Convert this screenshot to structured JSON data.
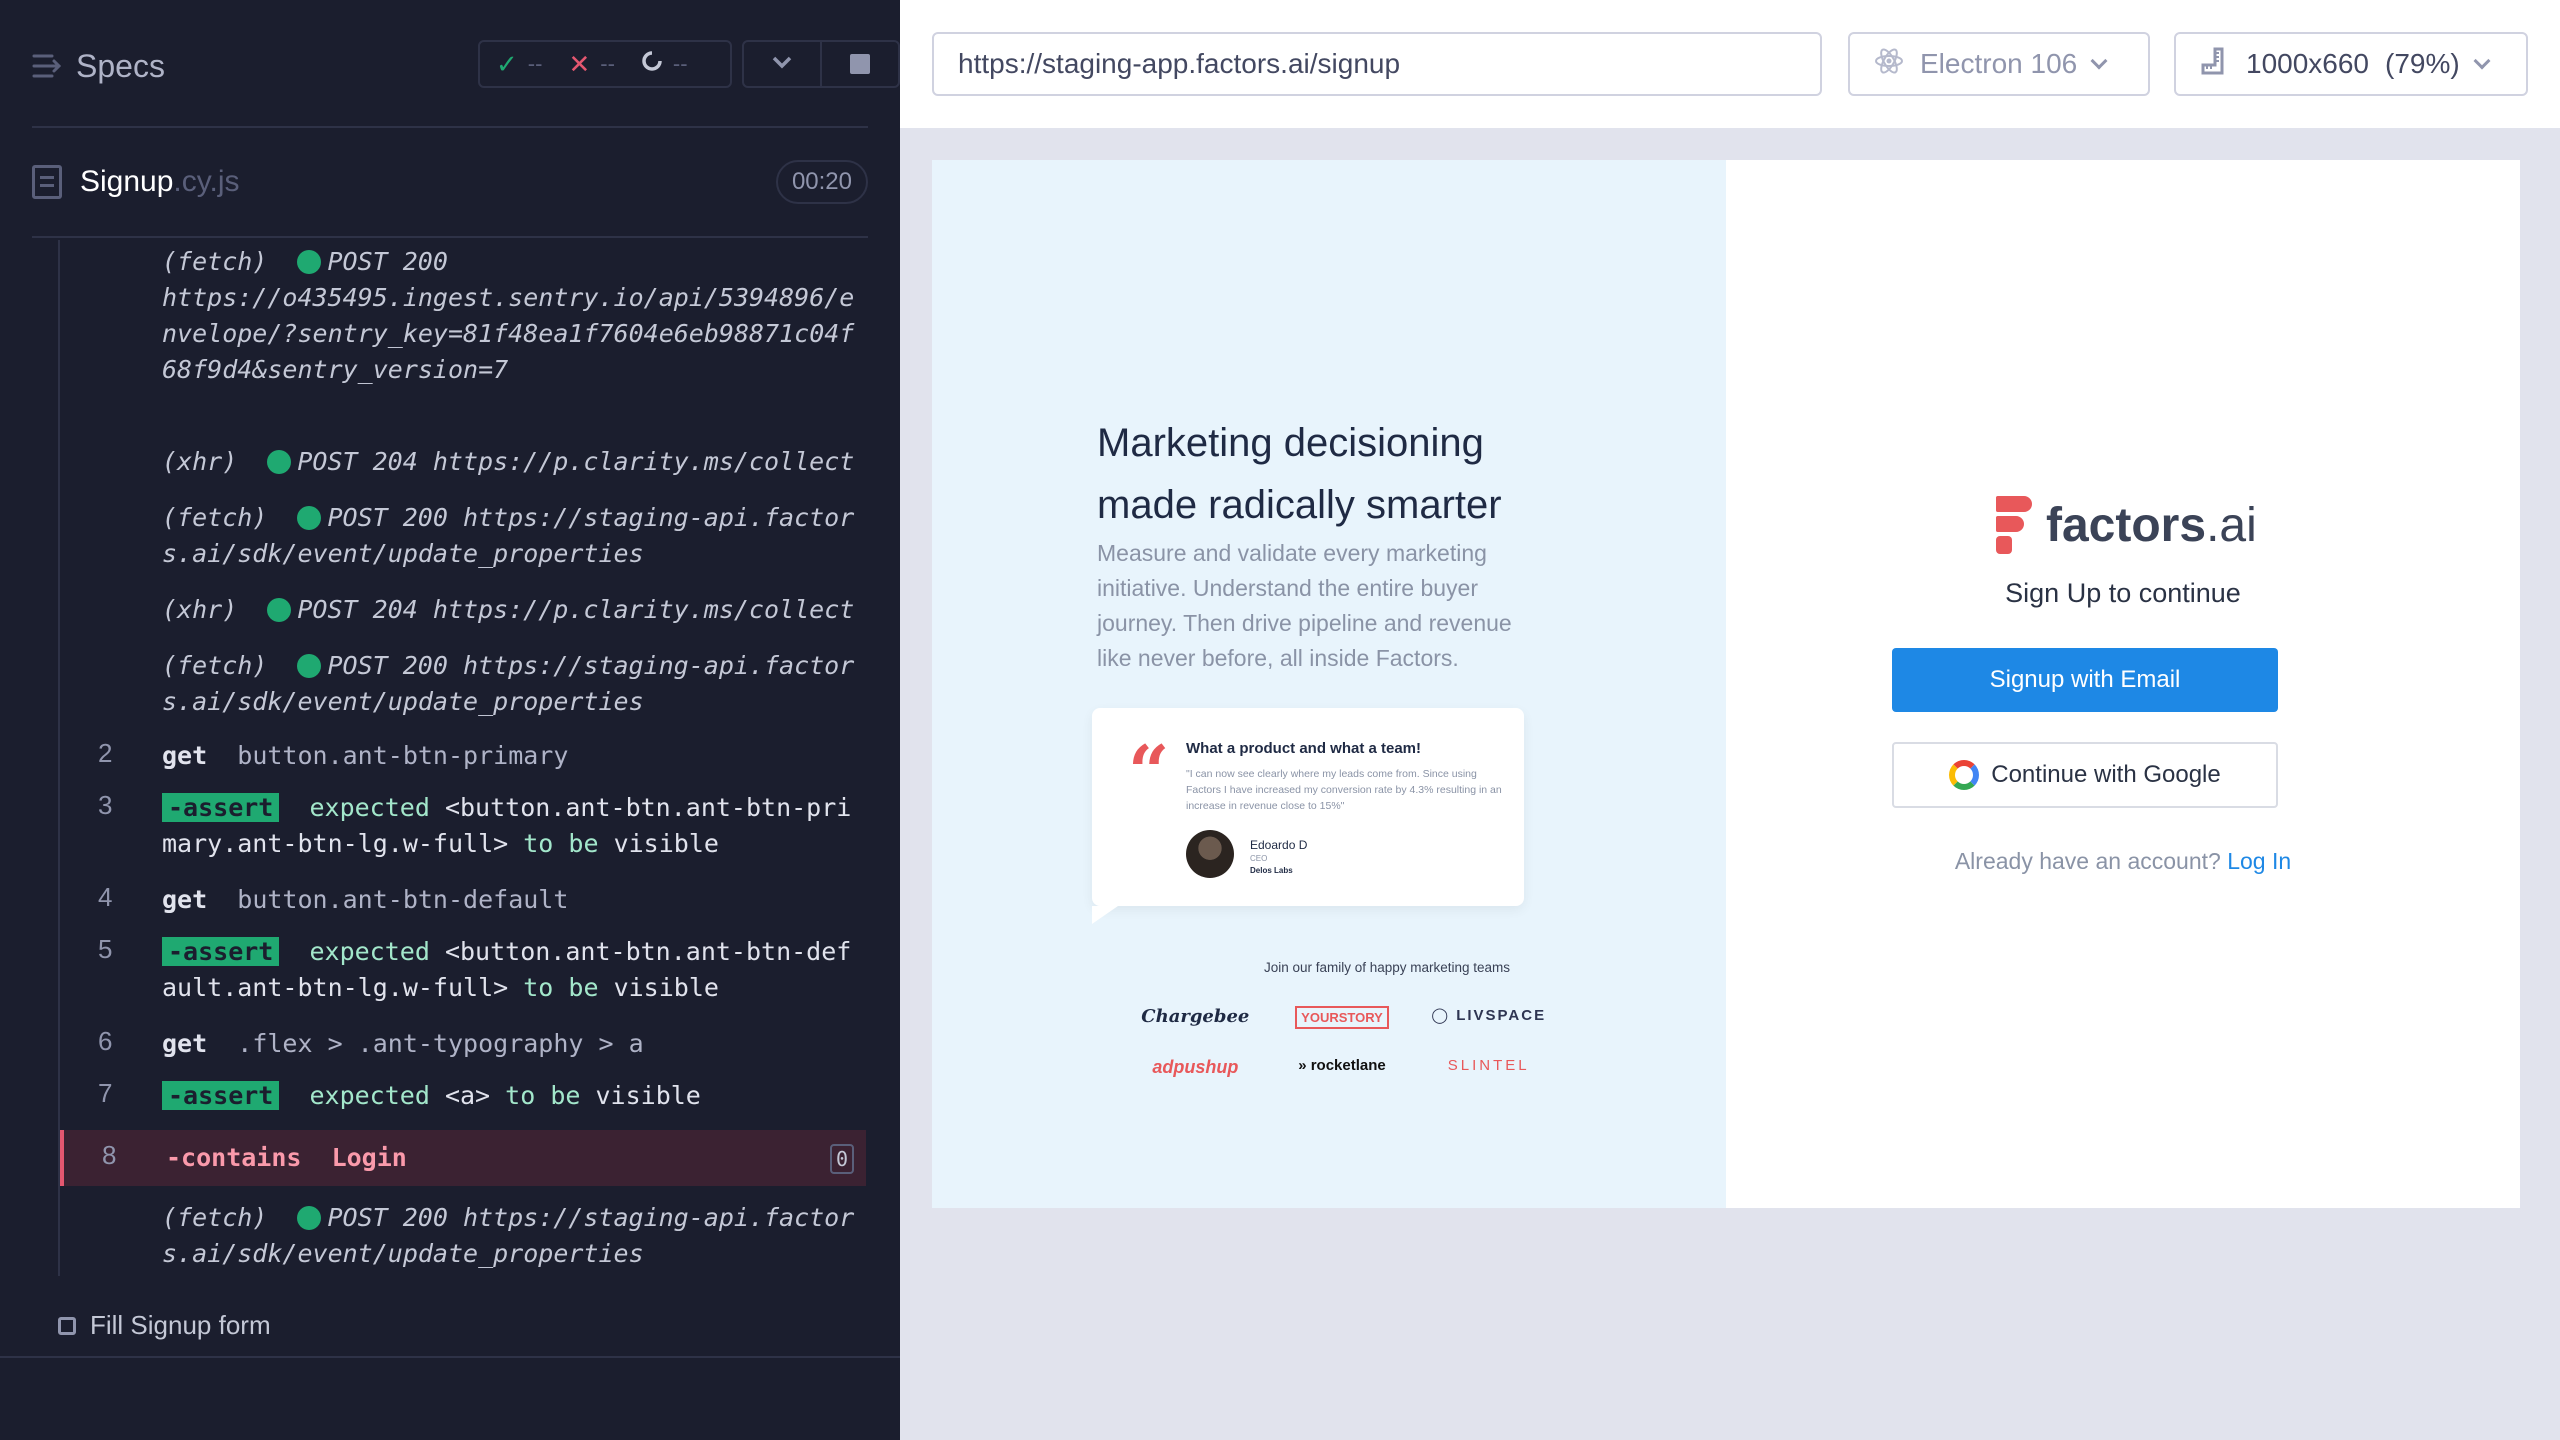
{
  "reporter": {
    "specs_label": "Specs",
    "stats": {
      "passed": "--",
      "failed": "--",
      "pending": "--"
    },
    "spec_file": {
      "name": "Signup",
      "ext": ".cy.js",
      "duration": "00:20"
    },
    "commands": [
      {
        "type": "event",
        "method": "(fetch)",
        "status": "POST 200",
        "text": "https://o435495.ingest.sentry.io/api/5394896/envelope/?sentry_key=81f48ea1f7604e6eb98871c04f68f9d4&sentry_version=7"
      },
      {
        "type": "event",
        "method": "(xhr)",
        "status": "POST 204",
        "text": "https://p.clarity.ms/collect"
      },
      {
        "type": "event",
        "method": "(fetch)",
        "status": "POST 200",
        "text": "https://staging-api.factors.ai/sdk/event/update_properties"
      },
      {
        "type": "event",
        "method": "(xhr)",
        "status": "POST 204",
        "text": "https://p.clarity.ms/collect"
      },
      {
        "type": "event",
        "method": "(fetch)",
        "status": "POST 200",
        "text": "https://staging-api.factors.ai/sdk/event/update_properties"
      },
      {
        "num": "2",
        "name": "get",
        "selector": "button.ant-btn-primary"
      },
      {
        "num": "3",
        "name": "-assert",
        "expected": "expected",
        "subject": "<button.ant-btn.ant-btn-primary.ant-btn-lg.w-full>",
        "tobe": "to be",
        "state": "visible"
      },
      {
        "num": "4",
        "name": "get",
        "selector": "button.ant-btn-default"
      },
      {
        "num": "5",
        "name": "-assert",
        "expected": "expected",
        "subject": "<button.ant-btn.ant-btn-default.ant-btn-lg.w-full>",
        "tobe": "to be",
        "state": "visible"
      },
      {
        "num": "6",
        "name": "get",
        "selector": ".flex > .ant-typography > a"
      },
      {
        "num": "7",
        "name": "-assert",
        "expected": "expected",
        "subject": "<a>",
        "tobe": "to be",
        "state": "visible"
      },
      {
        "num": "8",
        "name": "-contains",
        "selector": "Login",
        "count": "0"
      },
      {
        "type": "event",
        "method": "(fetch)",
        "status": "POST 200",
        "text": "https://staging-api.factors.ai/sdk/event/update_properties"
      }
    ],
    "suite_label": "Fill Signup form"
  },
  "aut": {
    "url": "https://staging-app.factors.ai/signup",
    "browser": "Electron 106",
    "viewport": "1000x660",
    "scale": "(79%)"
  },
  "app": {
    "hero_title": "Marketing decisioning made radically smarter",
    "hero_sub": "Measure and validate every marketing initiative. Understand the entire buyer journey. Then drive pipeline and revenue like never before, all inside Factors.",
    "testimonial": {
      "title": "What a product and what a team!",
      "text": "\"I can now see clearly where my leads come from. Since using Factors I have increased my conversion rate by 4.3% resulting in an increase in revenue close to 15%\"",
      "name": "Edoardo D",
      "role": "CEO",
      "company": "Delos Labs"
    },
    "join_text": "Join our family of happy marketing teams",
    "logos": [
      "Chargebee",
      "YOURSTORY",
      "LIVSPACE",
      "adpushup",
      "rocketlane",
      "SLINTEL"
    ],
    "brand": {
      "name": "factors",
      "suffix": ".ai"
    },
    "signup_title": "Sign Up to continue",
    "email_button": "Signup with Email",
    "google_button": "Continue with Google",
    "account_prompt": "Already have an account?",
    "login_link": "Log In",
    "colors": {
      "primary": "#1e88e5",
      "brand": "#e8585a",
      "pass": "#1fa971",
      "fail": "#e45770"
    }
  }
}
